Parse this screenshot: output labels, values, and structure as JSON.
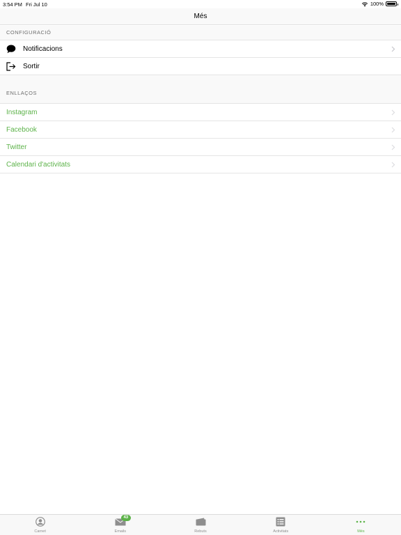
{
  "status_bar": {
    "time": "3:54 PM",
    "date": "Fri Jul 10",
    "battery": "100%"
  },
  "nav": {
    "title": "Més"
  },
  "sections": {
    "config": {
      "header": "CONFIGURACIÓ",
      "items": [
        {
          "label": "Notificacions",
          "icon": "chat-bubble-icon"
        },
        {
          "label": "Sortir",
          "icon": "logout-icon"
        }
      ]
    },
    "links": {
      "header": "ENLLAÇOS",
      "items": [
        {
          "label": "Instagram"
        },
        {
          "label": "Facebook"
        },
        {
          "label": "Twitter"
        },
        {
          "label": "Calendari d'activitats"
        }
      ]
    }
  },
  "tab_bar": {
    "tabs": [
      {
        "label": "Carnet",
        "icon": "person-icon"
      },
      {
        "label": "Emails",
        "icon": "mail-icon",
        "badge": "43"
      },
      {
        "label": "Rebuts",
        "icon": "wallet-icon"
      },
      {
        "label": "Activitats",
        "icon": "list-icon"
      },
      {
        "label": "Més",
        "icon": "more-icon",
        "active": true
      }
    ]
  },
  "colors": {
    "accent": "#5db34a",
    "inactive": "#8e8e8e"
  }
}
